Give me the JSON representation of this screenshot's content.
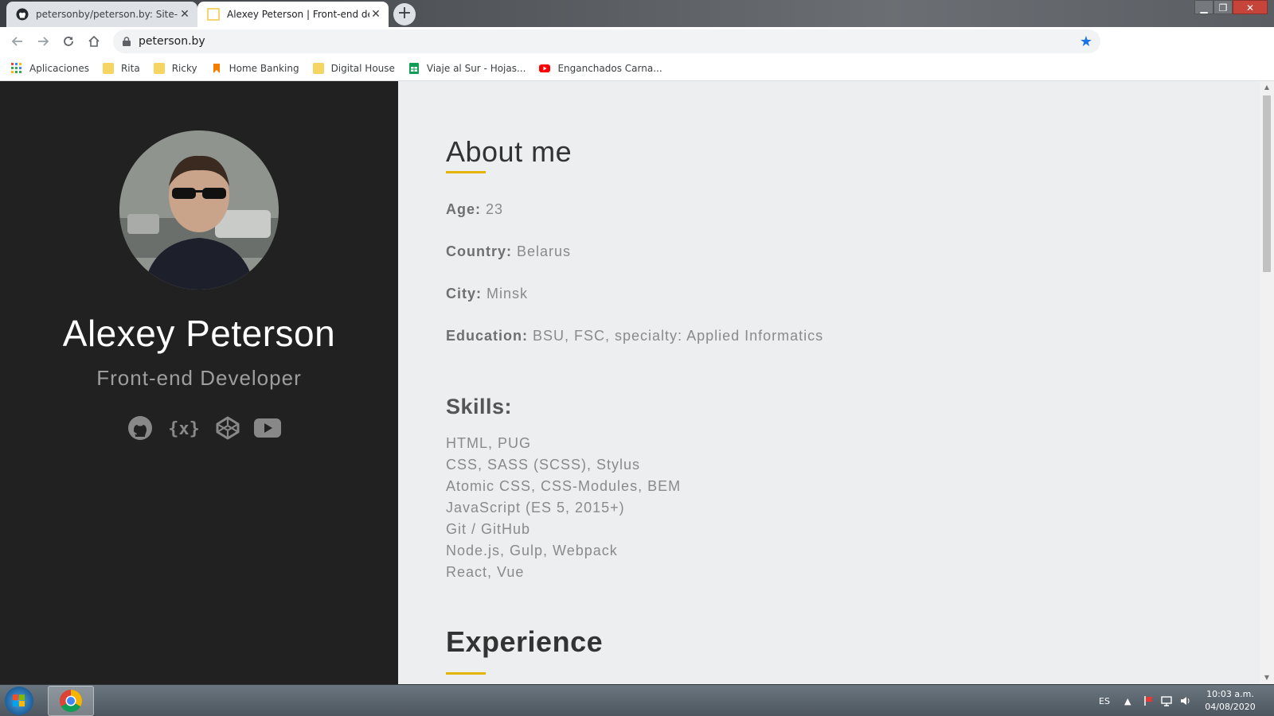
{
  "browser": {
    "tabs": [
      {
        "title": "petersonby/peterson.by: Site-por"
      },
      {
        "title": "Alexey Peterson | Front-end deve"
      }
    ],
    "new_tab_label": "+",
    "url": "peterson.by"
  },
  "bookmarks": [
    {
      "label": "Aplicaciones",
      "icon": "apps-grid-icon"
    },
    {
      "label": "Rita",
      "icon": "folder-icon"
    },
    {
      "label": "Ricky",
      "icon": "folder-icon"
    },
    {
      "label": "Home Banking",
      "icon": "bank-icon"
    },
    {
      "label": "Digital House",
      "icon": "folder-icon"
    },
    {
      "label": "Viaje al Sur - Hojas...",
      "icon": "sheets-icon"
    },
    {
      "label": "Enganchados Carna...",
      "icon": "youtube-icon"
    }
  ],
  "profile": {
    "name": "Alexey Peterson",
    "role": "Front-end Developer",
    "socials": [
      "github-icon",
      "codewars-icon",
      "codepen-icon",
      "youtube-icon"
    ]
  },
  "about": {
    "heading": "About me",
    "fields": [
      {
        "label": "Age:",
        "value": "23"
      },
      {
        "label": "Country:",
        "value": "Belarus"
      },
      {
        "label": "City:",
        "value": "Minsk"
      },
      {
        "label": "Education:",
        "value": "BSU, FSC, specialty: Applied Informatics"
      }
    ]
  },
  "skills": {
    "heading": "Skills:",
    "items": [
      "HTML, PUG",
      "CSS, SASS (SCSS), Stylus",
      "Atomic CSS, CSS-Modules, BEM",
      "JavaScript (ES 5, 2015+)",
      "Git / GitHub",
      "Node.js, Gulp, Webpack",
      "React, Vue"
    ]
  },
  "experience": {
    "heading": "Experience"
  },
  "taskbar": {
    "language": "ES",
    "time": "10:03 a.m.",
    "date": "04/08/2020"
  },
  "colors": {
    "accent": "#e5b400",
    "sidebar_bg": "#212121",
    "content_bg": "#eceeef"
  }
}
